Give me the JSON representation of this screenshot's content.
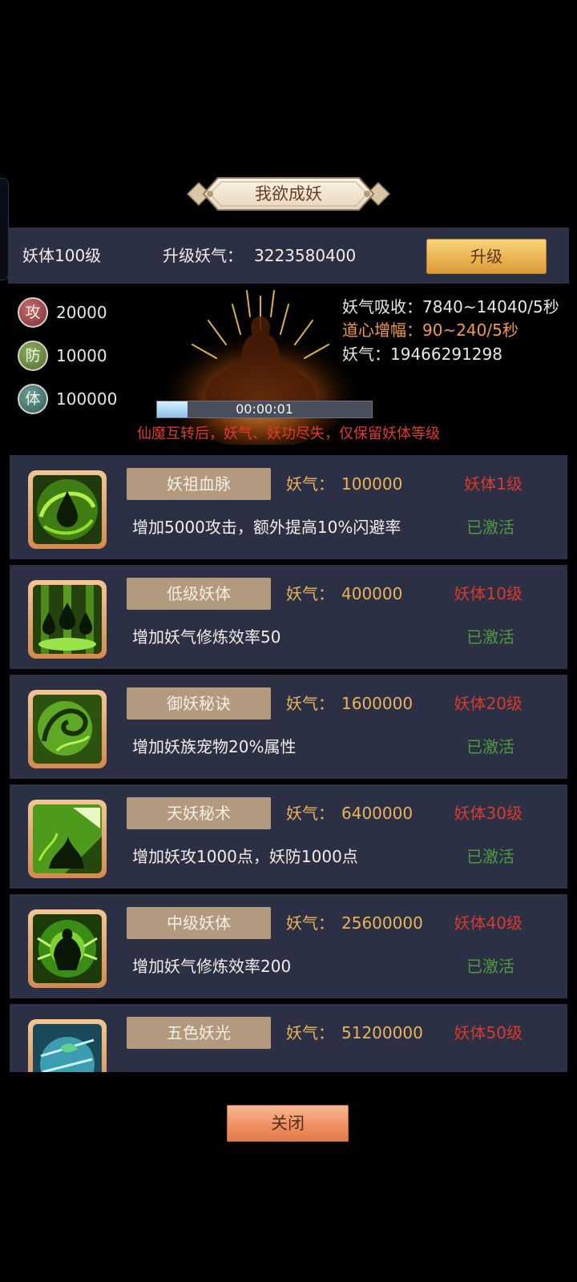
{
  "title": "我欲成妖",
  "header": {
    "level_text": "妖体100级",
    "upgrade_cost_label": "升级妖气：",
    "upgrade_cost_value": "3223580400",
    "upgrade_button": "升级"
  },
  "stats": [
    {
      "badge": "攻",
      "value": "20000"
    },
    {
      "badge": "防",
      "value": "10000"
    },
    {
      "badge": "体",
      "value": "100000"
    }
  ],
  "info": {
    "absorb": "妖气吸收：7840~14040/5秒",
    "daoxin": "道心增幅：90~240/5秒",
    "yaoqi": "妖气：19466291298"
  },
  "progress": {
    "time": "00:00:01",
    "fraction": 0.14
  },
  "warning": "仙魔互转后，妖气、妖功尽失，仅保留妖体等级",
  "cards": [
    {
      "name": "妖祖血脉",
      "cost_label": "妖气：",
      "cost": "100000",
      "requirement": "妖体1级",
      "description": "增加5000攻击，额外提高10%闪避率",
      "status": "已激活",
      "icon": "blood-drop-icon"
    },
    {
      "name": "低级妖体",
      "cost_label": "妖气：",
      "cost": "400000",
      "requirement": "妖体10级",
      "description": "增加妖气修炼效率50",
      "status": "已激活",
      "icon": "triple-drop-icon"
    },
    {
      "name": "御妖秘诀",
      "cost_label": "妖气：",
      "cost": "1600000",
      "requirement": "妖体20级",
      "description": "增加妖族宠物20%属性",
      "status": "已激活",
      "icon": "spirit-beast-icon"
    },
    {
      "name": "天妖秘术",
      "cost_label": "妖气：",
      "cost": "6400000",
      "requirement": "妖体30级",
      "description": "增加妖攻1000点，妖防1000点",
      "status": "已激活",
      "icon": "sky-demon-icon"
    },
    {
      "name": "中级妖体",
      "cost_label": "妖气：",
      "cost": "25600000",
      "requirement": "妖体40级",
      "description": "增加妖气修炼效率200",
      "status": "已激活",
      "icon": "green-figure-icon"
    },
    {
      "name": "五色妖光",
      "cost_label": "妖气：",
      "cost": "51200000",
      "requirement": "妖体50级",
      "description": "",
      "status": "",
      "icon": "five-color-light-icon"
    }
  ],
  "close_button": "关闭",
  "colors": {
    "panel": "#2b3044",
    "cost": "#eab35b",
    "requirement": "#d93a2e",
    "active": "#4f9a3e",
    "warning": "#e03a30"
  }
}
